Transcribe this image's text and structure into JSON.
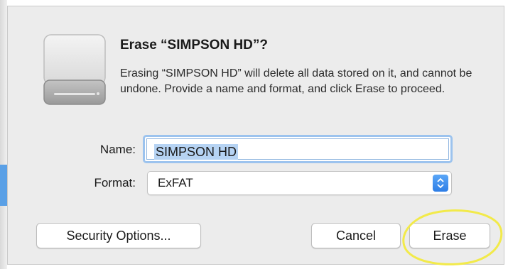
{
  "dialog": {
    "title": "Erase “SIMPSON HD”?",
    "message": "Erasing “SIMPSON HD” will delete all data stored on it, and cannot be undone. Provide a name and format, and click Erase to proceed.",
    "icon": "drive-icon"
  },
  "form": {
    "name_label": "Name:",
    "name_value": "SIMPSON HD",
    "format_label": "Format:",
    "format_value": "ExFAT"
  },
  "buttons": {
    "security_options": "Security Options...",
    "cancel": "Cancel",
    "erase": "Erase"
  },
  "colors": {
    "accent": "#2e7ee6",
    "focus_ring": "#9cc3ee",
    "selection": "#b6d3f3",
    "annotation": "#f2ea4a"
  }
}
